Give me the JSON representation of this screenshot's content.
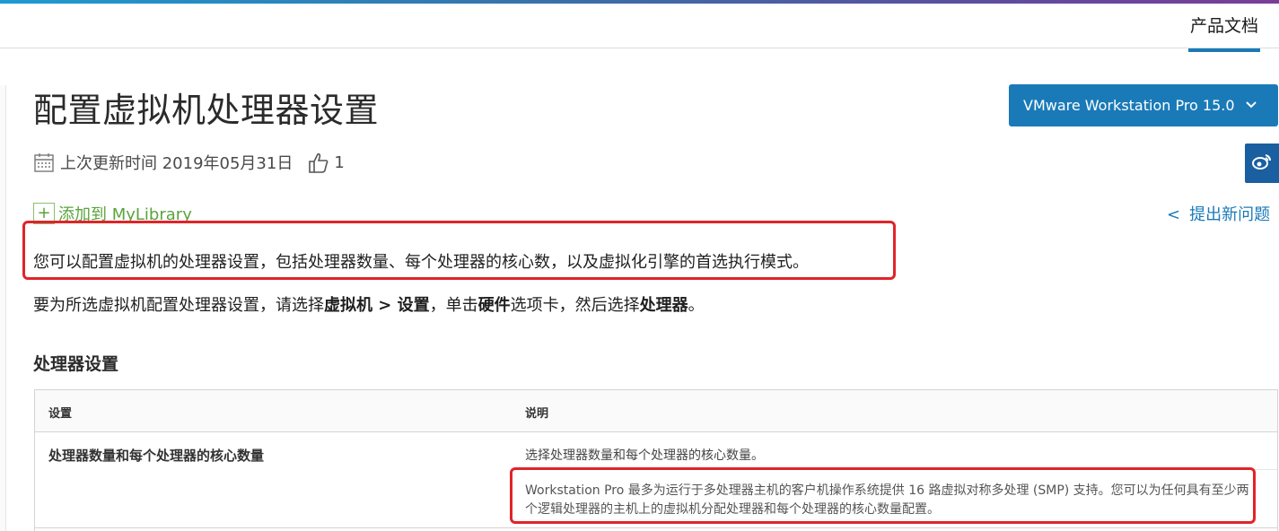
{
  "header": {
    "nav_docs": "产品文档"
  },
  "page": {
    "title": "配置虚拟机处理器设置",
    "version_label": "VMware Workstation Pro 15.0",
    "last_updated_label": "上次更新时间 2019年05月31日",
    "likes": "1",
    "add_to_library": "添加到 MyLibrary",
    "feedback_link": "提出新问题",
    "feedback_prefix": "<",
    "intro": "您可以配置虚拟机的处理器设置，包括处理器数量、每个处理器的核心数，以及虚拟化引擎的首选执行模式。",
    "instr_part1": "要为所选虚拟机配置处理器设置，请选择",
    "instr_bold1": "虚拟机 > 设置",
    "instr_part2": "，单击",
    "instr_bold2": "硬件",
    "instr_part3": "选项卡，然后选择",
    "instr_bold3": "处理器",
    "instr_part4": "。",
    "section_title": "处理器设置"
  },
  "table": {
    "headers": [
      "设置",
      "说明"
    ],
    "rows": [
      {
        "setting": "处理器数量和每个处理器的核心数量",
        "desc1": "选择处理器数量和每个处理器的核心数量。",
        "desc2": "Workstation Pro 最多为运行于多处理器主机的客户机操作系统提供 16 路虚拟对称多处理 (SMP) 支持。您可以为任何具有至少两个逻辑处理器的主机上的虚拟机分配处理器和每个处理器的核心数量配置。"
      }
    ]
  },
  "colors": {
    "accent": "#1a7ab8",
    "highlight_border": "#e0242a",
    "library_green": "#5aa33c"
  },
  "icons": {
    "calendar": "calendar-icon",
    "thumbs_up": "thumbs-up-icon",
    "plus": "plus-icon",
    "weibo": "weibo-icon",
    "chevron": "chevron-down-icon"
  }
}
